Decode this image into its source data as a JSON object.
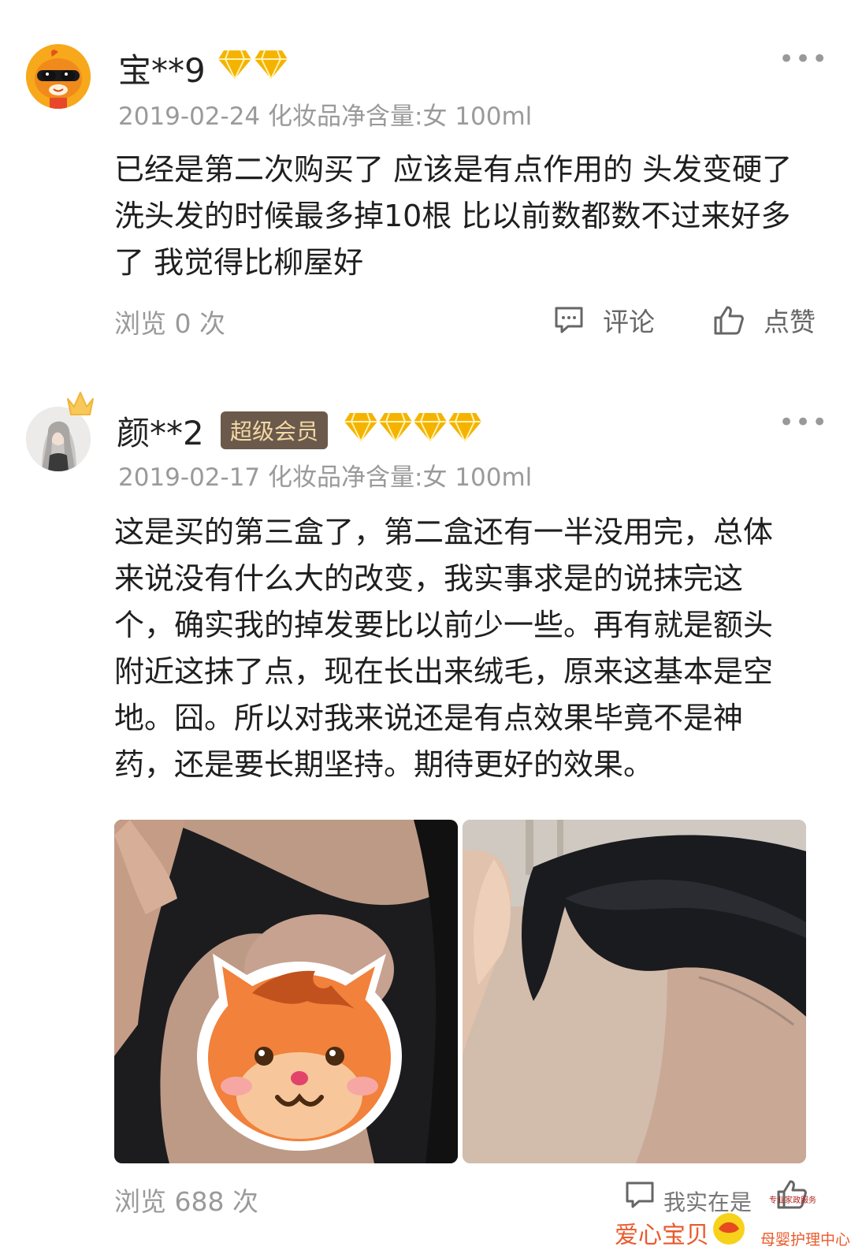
{
  "reviews": [
    {
      "user": "宝**9",
      "date_spec": "2019-02-24 化妆品净含量:女 100ml",
      "content": "已经是第二次购买了 应该是有点作用的 头发变硬了 洗头发的时候最多掉10根 比以前数都数不过来好多了 我觉得比柳屋好",
      "views": "浏览 0 次",
      "comment_label": "评论",
      "like_label": "点赞",
      "diamonds": 2
    },
    {
      "user": "颜**2",
      "badge": "超级会员",
      "date_spec": "2019-02-17 化妆品净含量:女 100ml",
      "content": "这是买的第三盒了，第二盒还有一半没用完，总体来说没有什么大的改变，我实事求是的说抹完这个，确实我的掉发要比以前少一些。再有就是额头附近这抹了点，现在长出来绒毛，原来这基本是空地。囧。所以对我来说还是有点效果毕竟不是神药，还是要长期坚持。期待更好的效果。",
      "views": "浏览 688 次",
      "diamonds": 4
    }
  ],
  "watermark": {
    "line1": "我实在是",
    "brand": "爱心宝贝",
    "sub": "母婴护理中心",
    "tiny": "专业家政服务"
  },
  "colors": {
    "diamond": "#f5b300",
    "badge_bg": "#6b5a4c",
    "badge_text": "#f3d9a6",
    "meta": "#9a9a9a"
  }
}
